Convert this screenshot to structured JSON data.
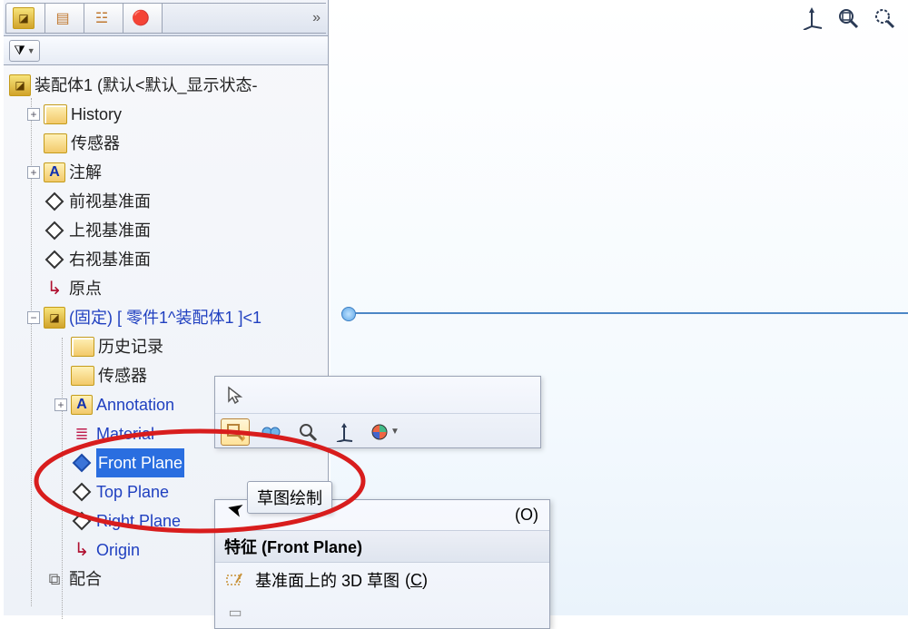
{
  "assembly": {
    "root_label": "装配体1  (默认<默认_显示状态-"
  },
  "tree": {
    "history": "History",
    "sensors": "传感器",
    "annotations": "注解",
    "front": "前视基准面",
    "top": "上视基准面",
    "right": "右视基准面",
    "origin": "原点",
    "part": "(固定) [ 零件1^装配体1 ]<1",
    "child": {
      "history": "历史记录",
      "sensors": "传感器",
      "annotations": "Annotation",
      "material": "Material",
      "front": "Front Plane",
      "top": "Top Plane",
      "right": "Right Plane",
      "origin": "Origin"
    },
    "mates": "配合"
  },
  "tooltip": {
    "text": "草图绘制"
  },
  "context_menu": {
    "top_item_suffix": "(O)",
    "header": "特征 (Front Plane)",
    "item1_label": "基准面上的 3D 草图",
    "item1_key": "(C)"
  },
  "icons": {
    "filter": "▼",
    "triad": "⤧",
    "zoom_fit": "🔍",
    "zoom_area": "🔍"
  }
}
